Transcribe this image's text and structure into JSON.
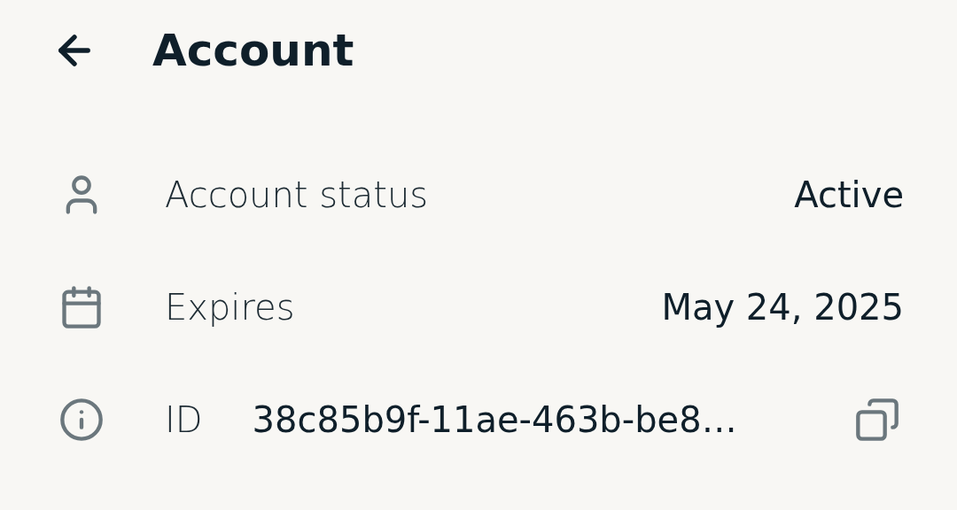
{
  "header": {
    "title": "Account"
  },
  "rows": [
    {
      "kind": "status",
      "label": "Account status",
      "value": "Active"
    },
    {
      "kind": "date",
      "label": "Expires",
      "value": "May 24, 2025"
    },
    {
      "kind": "id",
      "label": "ID",
      "value": "38c85b9f-11ae-463b-be8…"
    }
  ]
}
